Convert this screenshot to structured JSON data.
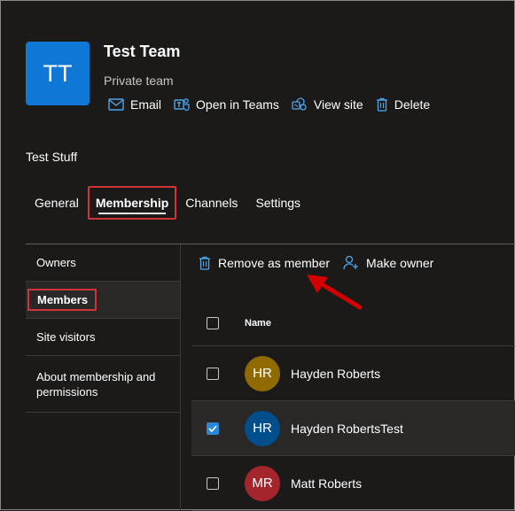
{
  "team": {
    "initials": "TT",
    "title": "Test Team",
    "privacy": "Private team",
    "actions": [
      "Email",
      "Open in Teams",
      "View site",
      "Delete"
    ]
  },
  "site_name": "Test Stuff",
  "tabs": [
    "General",
    "Membership",
    "Channels",
    "Settings"
  ],
  "active_tab": "Membership",
  "left_nav": [
    "Owners",
    "Members",
    "Site visitors",
    "About membership and permissions"
  ],
  "command_bar": {
    "remove": "Remove as member",
    "make_owner": "Make owner"
  },
  "table": {
    "header_name": "Name",
    "rows": [
      {
        "initials": "HR",
        "name": "Hayden Roberts",
        "checked": false,
        "color": "#8f6a00"
      },
      {
        "initials": "HR",
        "name": "Hayden RobertsTest",
        "checked": true,
        "color": "#004e8c"
      },
      {
        "initials": "MR",
        "name": "Matt Roberts",
        "checked": false,
        "color": "#a4262c"
      }
    ]
  },
  "colors": {
    "accent": "#0f78d4",
    "highlight": "#d13438",
    "checkbox": "#2b88d8"
  }
}
